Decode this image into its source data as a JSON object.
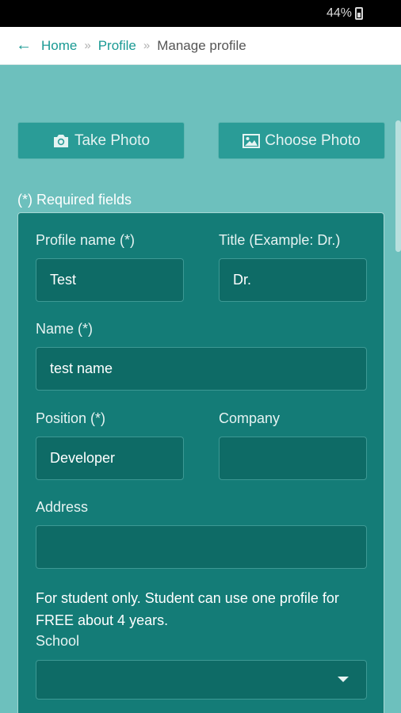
{
  "status_bar": {
    "battery": "44%"
  },
  "breadcrumb": {
    "home": "Home",
    "profile": "Profile",
    "current": "Manage profile",
    "separator": "»"
  },
  "photo": {
    "take_label": "Take Photo",
    "choose_label": "Choose Photo"
  },
  "required_note": "(*) Required fields",
  "form": {
    "profile_name": {
      "label": "Profile name (*)",
      "value": "Test"
    },
    "title": {
      "label": "Title (Example: Dr.)",
      "value": "Dr."
    },
    "name": {
      "label": "Name (*)",
      "value": "test name"
    },
    "position": {
      "label": "Position (*)",
      "value": "Developer"
    },
    "company": {
      "label": "Company",
      "value": ""
    },
    "address": {
      "label": "Address",
      "value": ""
    },
    "student_note": "For student only. Student can use one profile for FREE about 4 years.",
    "school": {
      "label": "School",
      "value": ""
    }
  },
  "colors": {
    "accent": "#1a9a94",
    "background": "#6dc0bd",
    "panel": "#147c77",
    "input": "#0e6b66"
  }
}
